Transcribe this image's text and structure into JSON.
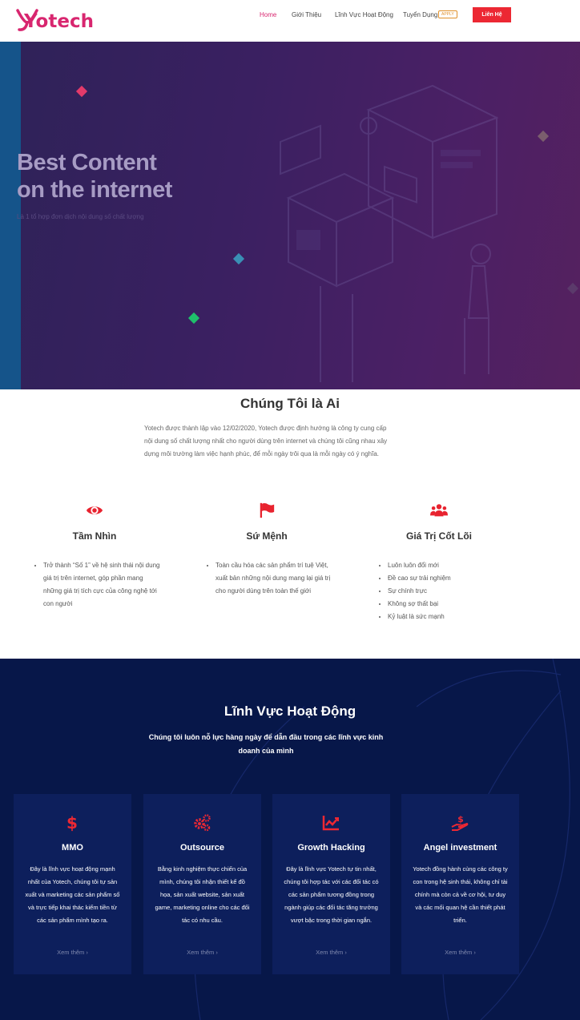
{
  "header": {
    "logo_text": "Yotech",
    "nav": [
      {
        "label": "Home"
      },
      {
        "label": "Giới Thiệu"
      },
      {
        "label": "Lĩnh Vực Hoạt Động"
      },
      {
        "label": "Tuyển Dụng"
      }
    ],
    "apply_badge": "APPLY",
    "contact_button": "Liên Hệ"
  },
  "hero": {
    "title_line1": "Best Content",
    "title_line2": "on the internet",
    "subtitle": "Là 1 tổ hợp đơn dịch nội dung số chất lượng"
  },
  "about": {
    "title": "Chúng Tôi là Ai",
    "text": "Yotech được thành lập vào 12/02/2020, Yotech được định hướng là công ty cung cấp nội dung số chất lượng nhất cho người dùng trên internet và chúng tôi cũng nhau xây dựng môi trường làm việc hạnh phúc, để mỗi ngày trôi qua là mỗi ngày có ý nghĩa.",
    "columns": [
      {
        "icon": "eye-icon",
        "title": "Tầm Nhìn",
        "items": [
          "Trở thành “Số 1” về hệ sinh thái nội dung giá trị trên internet, góp phần mang những giá trị tích cực của công nghệ tới con người"
        ]
      },
      {
        "icon": "flag-icon",
        "title": "Sứ Mệnh",
        "items": [
          "Toàn cầu hóa các sản phẩm trí tuệ Việt, xuất bản những nội dung mang lại giá trị cho người dùng trên toàn thế giới"
        ]
      },
      {
        "icon": "users-icon",
        "title": "Giá Trị Cốt Lõi",
        "items": [
          "Luôn luôn đổi mới",
          "Đề cao sự trải nghiệm",
          "Sự chính trực",
          "Không sợ thất bại",
          "Kỷ luật là sức mạnh"
        ]
      }
    ]
  },
  "services": {
    "title": "Lĩnh Vực Hoạt Động",
    "subtitle": "Chúng tôi luôn nỗ lực hàng ngày để dẫn đầu trong các lĩnh vực kinh doanh của mình",
    "cards": [
      {
        "icon": "dollar-icon",
        "title": "MMO",
        "text": "Đây là lĩnh vực hoạt động mạnh nhất của Yotech, chúng tôi tự sản xuất và marketing các sản phẩm số và trực tiếp khai thác kiếm tiền từ các sản phẩm mình tạo ra.",
        "more": "Xem thêm ›"
      },
      {
        "icon": "gears-icon",
        "title": "Outsource",
        "text": "Bằng kinh nghiệm thực chiến của mình, chúng tôi nhận thiết kế đồ họa, sản xuất website, sản xuất game, marketing online cho các đối tác có nhu cầu.",
        "more": "Xem thêm ›"
      },
      {
        "icon": "chart-line-icon",
        "title": "Growth Hacking",
        "text": "Đây là lĩnh vực Yotech tự tin nhất, chúng tôi hợp tác với các đối tác có các sản phẩm tương đồng trong ngành giúp các đối tác tăng trưởng vượt bậc trong thời gian ngắn.",
        "more": "Xem thêm ›"
      },
      {
        "icon": "hand-money-icon",
        "title": "Angel investment",
        "text": "Yotech đồng hành cùng các công ty con trong hệ sinh thái, không chỉ tài chính mà còn cả về cơ hội, tư duy và các mối quan hệ cần thiết phát triển.",
        "more": "Xem thêm ›"
      }
    ]
  },
  "colors": {
    "brand": "#d8266f",
    "accent_red": "#ec2833",
    "services_bg": "#071749",
    "card_bg": "#0d1f5c"
  }
}
